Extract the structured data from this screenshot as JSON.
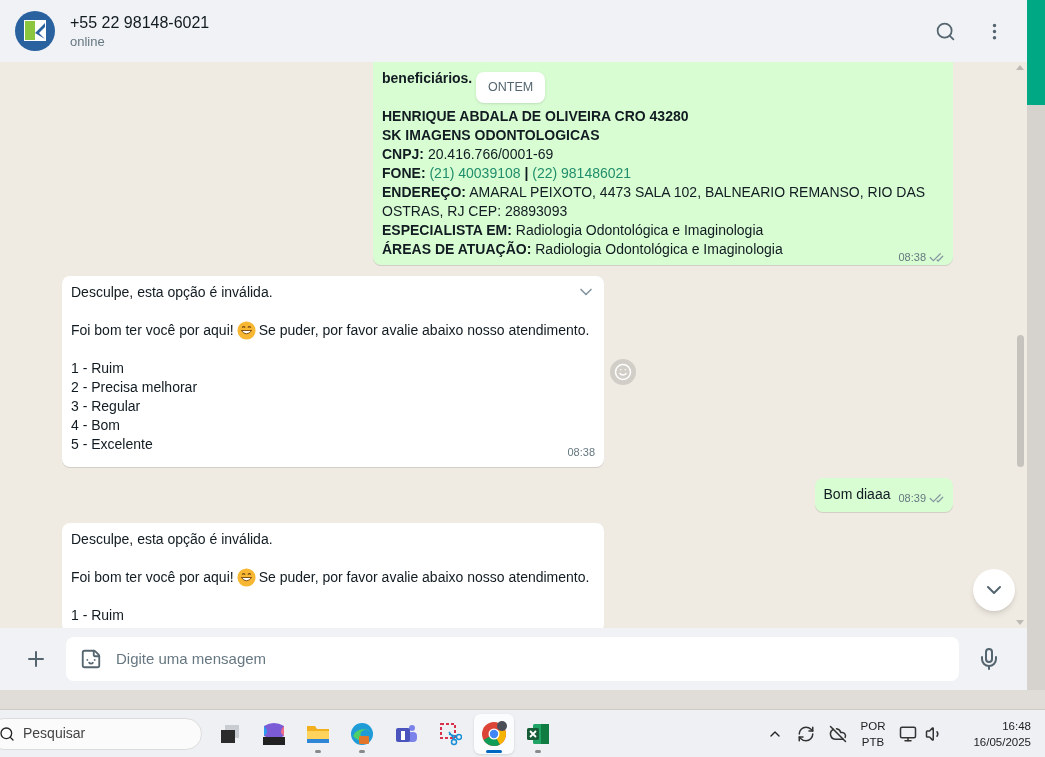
{
  "contact": {
    "name": "+55 22 98148-6021",
    "status": "online"
  },
  "date_chip": "ONTEM",
  "messages": [
    {
      "kind": "outgoing",
      "hovered": false,
      "read": false,
      "time": "08:38",
      "paragraphs": [
        [
          [
            {
              "kind": "bold",
              "text": "beneficiários."
            }
          ]
        ],
        [
          [
            {
              "kind": "bold",
              "text": "HENRIQUE ABDALA DE OLIVEIRA CRO 43280"
            }
          ],
          [
            {
              "kind": "bold",
              "text": "SK IMAGENS ODONTOLOGICAS"
            }
          ],
          [
            {
              "kind": "bold",
              "text": "CNPJ:"
            },
            {
              "kind": "plain",
              "text": "20.416.766/0001-69"
            }
          ],
          [
            {
              "kind": "bold",
              "text": "FONE:"
            },
            {
              "kind": "link",
              "text": "(21) 40039108"
            },
            {
              "kind": "bold",
              "text": "|"
            },
            {
              "kind": "link",
              "text": "(22) 981486021"
            }
          ],
          [
            {
              "kind": "bold",
              "text": "ENDEREÇO:"
            },
            {
              "kind": "plain",
              "text": "AMARAL PEIXOTO, 4473 SALA 102, BALNEARIO REMANSO, RIO DAS OSTRAS, RJ CEP: 28893093"
            }
          ],
          [
            {
              "kind": "bold",
              "text": "ESPECIALISTA EM:"
            },
            {
              "kind": "plain",
              "text": "Radiologia Odontológica e Imaginologia"
            }
          ],
          [
            {
              "kind": "bold",
              "text": "ÁREAS DE ATUAÇÃO:"
            },
            {
              "kind": "plain",
              "text": "Radiologia Odontológica e Imaginologia"
            }
          ]
        ]
      ]
    },
    {
      "kind": "incoming",
      "hovered": true,
      "time": "08:38",
      "paragraphs": [
        [
          [
            {
              "kind": "plain",
              "text": "Desculpe, esta opção é inválida."
            }
          ]
        ],
        [
          [
            {
              "kind": "plain",
              "text": "Foi bom ter você por aqui!"
            },
            {
              "kind": "emoji"
            },
            {
              "kind": "plain",
              "text": "Se puder, por favor avalie abaixo nosso atendimento."
            }
          ]
        ],
        [
          [
            {
              "kind": "plain",
              "text": "1 - Ruim"
            }
          ],
          [
            {
              "kind": "plain",
              "text": "2 - Precisa melhorar"
            }
          ],
          [
            {
              "kind": "plain",
              "text": "3 - Regular"
            }
          ],
          [
            {
              "kind": "plain",
              "text": "4 - Bom"
            }
          ],
          [
            {
              "kind": "plain",
              "text": "5 - Excelente"
            }
          ]
        ]
      ]
    },
    {
      "kind": "outgoing",
      "hovered": false,
      "read": false,
      "time": "08:39",
      "paragraphs": [
        [
          [
            {
              "kind": "plain",
              "text": "Bom diaaa"
            }
          ]
        ]
      ]
    },
    {
      "kind": "incoming",
      "hovered": false,
      "paragraphs": [
        [
          [
            {
              "kind": "plain",
              "text": "Desculpe, esta opção é inválida."
            }
          ]
        ],
        [
          [
            {
              "kind": "plain",
              "text": "Foi bom ter você por aqui!"
            },
            {
              "kind": "emoji"
            },
            {
              "kind": "plain",
              "text": "Se puder, por favor avalie abaixo nosso atendimento."
            }
          ]
        ],
        [
          [
            {
              "kind": "plain",
              "text": "1 - Ruim"
            }
          ]
        ]
      ]
    }
  ],
  "composer": {
    "placeholder": "Digite uma mensagem"
  },
  "taskbar": {
    "search_placeholder": "Pesquisar",
    "apps": [
      {
        "kind": "taskview",
        "open": false,
        "selected": false
      },
      {
        "kind": "m365",
        "open": false,
        "selected": false
      },
      {
        "kind": "folder",
        "open": true,
        "selected": false
      },
      {
        "kind": "edge",
        "open": true,
        "selected": false
      },
      {
        "kind": "teams",
        "open": false,
        "selected": false
      },
      {
        "kind": "snip",
        "open": false,
        "selected": false
      },
      {
        "kind": "chrome",
        "open": true,
        "selected": true
      },
      {
        "kind": "excel",
        "open": true,
        "selected": false
      }
    ],
    "language": [
      "POR",
      "PTB"
    ],
    "time": "16:48",
    "date": "16/05/2025"
  }
}
